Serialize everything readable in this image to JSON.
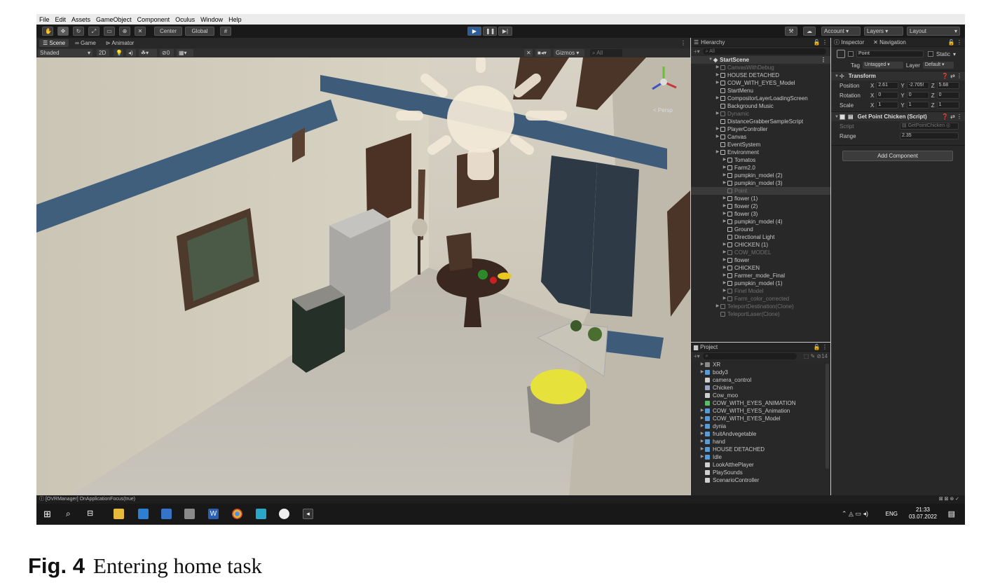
{
  "menu": [
    "File",
    "Edit",
    "Assets",
    "GameObject",
    "Component",
    "Oculus",
    "Window",
    "Help"
  ],
  "toolbar": {
    "pivot": "Center",
    "space": "Global",
    "account": "Account",
    "layers": "Layers",
    "layout": "Layout"
  },
  "scene_panel": {
    "tabs": [
      "Scene",
      "Game",
      "Animator"
    ],
    "shading": "Shaded",
    "mode_2d": "2D",
    "gizmos": "Gizmos",
    "search_placeholder": "All",
    "hidden_count": "0",
    "gizmo_label": "< Persp"
  },
  "hierarchy": {
    "title": "Hierarchy",
    "search_placeholder": "All",
    "scene_name": "StartScene",
    "items": [
      {
        "label": "CanvasWithDebug",
        "depth": 1,
        "arrow": true,
        "dim": true
      },
      {
        "label": "HOUSE DETACHED",
        "depth": 1,
        "arrow": true,
        "dim": false
      },
      {
        "label": "COW_WITH_EYES_Model",
        "depth": 1,
        "arrow": true,
        "dim": false
      },
      {
        "label": "StartMenu",
        "depth": 1,
        "arrow": false,
        "dim": false
      },
      {
        "label": "CompositorLayerLoadingScreen",
        "depth": 1,
        "arrow": true,
        "dim": false
      },
      {
        "label": "Background Music",
        "depth": 1,
        "arrow": false,
        "dim": false
      },
      {
        "label": "Dynamic",
        "depth": 1,
        "arrow": true,
        "dim": true
      },
      {
        "label": "DistanceGrabberSampleScript",
        "depth": 1,
        "arrow": false,
        "dim": false
      },
      {
        "label": "PlayerController",
        "depth": 1,
        "arrow": true,
        "dim": false
      },
      {
        "label": "Canvas",
        "depth": 1,
        "arrow": true,
        "dim": false
      },
      {
        "label": "EventSystem",
        "depth": 1,
        "arrow": false,
        "dim": false
      },
      {
        "label": "Environment",
        "depth": 1,
        "arrow": true,
        "dim": false
      },
      {
        "label": "Tomatos",
        "depth": 2,
        "arrow": true,
        "dim": false
      },
      {
        "label": "Farm2.0",
        "depth": 2,
        "arrow": true,
        "dim": false
      },
      {
        "label": "pumpkin_model (2)",
        "depth": 2,
        "arrow": true,
        "dim": false
      },
      {
        "label": "pumpkin_model (3)",
        "depth": 2,
        "arrow": true,
        "dim": false
      },
      {
        "label": "Point",
        "depth": 2,
        "arrow": false,
        "dim": true,
        "selected": true
      },
      {
        "label": "flower (1)",
        "depth": 2,
        "arrow": true,
        "dim": false
      },
      {
        "label": "flower (2)",
        "depth": 2,
        "arrow": true,
        "dim": false
      },
      {
        "label": "flower (3)",
        "depth": 2,
        "arrow": true,
        "dim": false
      },
      {
        "label": "pumpkin_model (4)",
        "depth": 2,
        "arrow": true,
        "dim": false
      },
      {
        "label": "Ground",
        "depth": 2,
        "arrow": false,
        "dim": false
      },
      {
        "label": "Directional Light",
        "depth": 2,
        "arrow": false,
        "dim": false
      },
      {
        "label": "CHICKEN (1)",
        "depth": 2,
        "arrow": true,
        "dim": false
      },
      {
        "label": "COW_MODEL",
        "depth": 2,
        "arrow": true,
        "dim": true
      },
      {
        "label": "flower",
        "depth": 2,
        "arrow": true,
        "dim": false
      },
      {
        "label": "CHICKEN",
        "depth": 2,
        "arrow": true,
        "dim": false
      },
      {
        "label": "Farmer_mode_Final",
        "depth": 2,
        "arrow": true,
        "dim": false
      },
      {
        "label": "pumpkin_model (1)",
        "depth": 2,
        "arrow": true,
        "dim": false
      },
      {
        "label": "Finel Model",
        "depth": 2,
        "arrow": true,
        "dim": true
      },
      {
        "label": "Farm_color_corrected",
        "depth": 2,
        "arrow": true,
        "dim": true
      },
      {
        "label": "TeleportDestination(Clone)",
        "depth": 1,
        "arrow": true,
        "dim": true
      },
      {
        "label": "TeleportLaser(Clone)",
        "depth": 1,
        "arrow": false,
        "dim": true
      }
    ]
  },
  "project": {
    "title": "Project",
    "badge": "14",
    "items": [
      {
        "label": "XR",
        "kind": "folder",
        "arrow": true
      },
      {
        "label": "body3",
        "kind": "model",
        "arrow": true
      },
      {
        "label": "camera_control",
        "kind": "script",
        "arrow": false
      },
      {
        "label": "Chicken",
        "kind": "anim",
        "arrow": false
      },
      {
        "label": "Cow_moo",
        "kind": "script",
        "arrow": false
      },
      {
        "label": "COW_WITH_EYES_ANIMATION",
        "kind": "clip",
        "arrow": false
      },
      {
        "label": "COW_WITH_EYES_Animation",
        "kind": "model",
        "arrow": true
      },
      {
        "label": "COW_WITH_EYES_Model",
        "kind": "model",
        "arrow": true
      },
      {
        "label": "dynia",
        "kind": "model",
        "arrow": true
      },
      {
        "label": "fruitAndvegetable",
        "kind": "model",
        "arrow": true
      },
      {
        "label": "hand",
        "kind": "model",
        "arrow": true
      },
      {
        "label": "HOUSE DETACHED",
        "kind": "model",
        "arrow": true
      },
      {
        "label": "Idle",
        "kind": "model",
        "arrow": true
      },
      {
        "label": "LookAtthePlayer",
        "kind": "script",
        "arrow": false
      },
      {
        "label": "PlaySounds",
        "kind": "script",
        "arrow": false
      },
      {
        "label": "ScenarioController",
        "kind": "script",
        "arrow": false
      }
    ]
  },
  "inspector": {
    "tabs": [
      "Inspector",
      "Navigation"
    ],
    "object_name": "Point",
    "static_label": "Static",
    "tag_label": "Tag",
    "tag_value": "Untagged",
    "layer_label": "Layer",
    "layer_value": "Default",
    "transform_title": "Transform",
    "position_label": "Position",
    "rotation_label": "Rotation",
    "scale_label": "Scale",
    "position": {
      "x": "2.61",
      "y": "-2.705!",
      "z": "5.68"
    },
    "rotation": {
      "x": "0",
      "y": "0",
      "z": "0"
    },
    "scale": {
      "x": "1",
      "y": "1",
      "z": "1"
    },
    "script_component_title": "Get Point Chicken (Script)",
    "script_label": "Script",
    "script_value": "GetPointChicken",
    "range_label": "Range",
    "range_value": "2.35",
    "add_component": "Add Component"
  },
  "status": "[OVRManager] OnApplicationFocus(true)",
  "taskbar": {
    "lang": "ENG",
    "time": "21:33",
    "date": "03.07.2022"
  },
  "caption": {
    "label": "Fig. 4",
    "text": "Entering home task"
  }
}
